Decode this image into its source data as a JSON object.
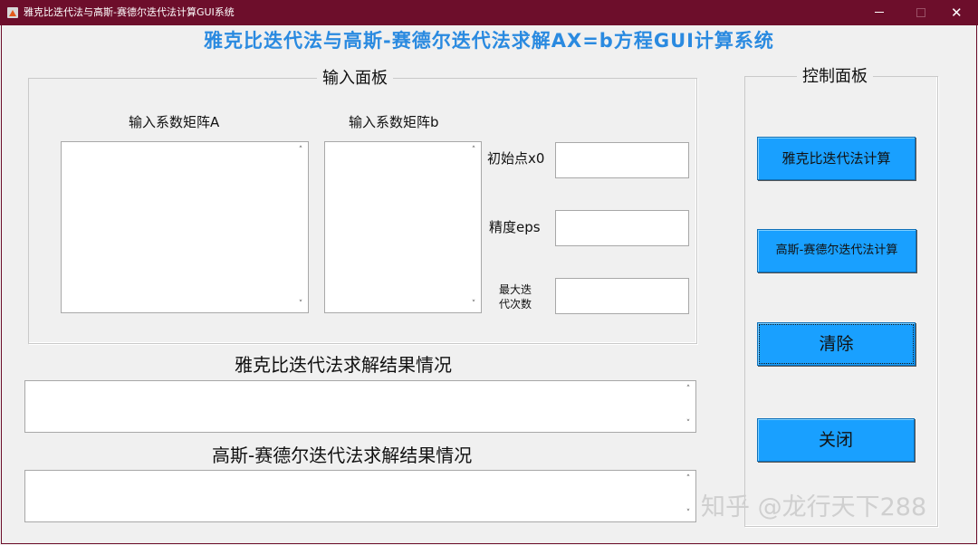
{
  "window": {
    "title": "雅克比迭代法与高斯-赛德尔迭代法计算GUI系统",
    "minimize": "",
    "maximize": "",
    "close": "✕"
  },
  "main_title": "雅克比迭代法与高斯-赛德尔迭代法求解AX=b方程GUI计算系统",
  "input_panel": {
    "title": "输入面板",
    "matrix_a_label": "输入系数矩阵A",
    "matrix_b_label": "输入系数矩阵b",
    "x0_label": "初始点x0",
    "eps_label": "精度eps",
    "max_iter_label_line1": "最大迭",
    "max_iter_label_line2": "代次数",
    "matrix_a_value": "",
    "matrix_b_value": "",
    "x0_value": "",
    "eps_value": "",
    "max_iter_value": ""
  },
  "results": {
    "jacobi_label": "雅克比迭代法求解结果情况",
    "gauss_label": "高斯-赛德尔迭代法求解结果情况",
    "jacobi_value": "",
    "gauss_value": ""
  },
  "control_panel": {
    "title": "控制面板",
    "jacobi_button": "雅克比迭代法计算",
    "gauss_button": "高斯-赛德尔迭代法计算",
    "clear_button": "清除",
    "close_button": "关闭"
  },
  "scroll": {
    "up": "˄",
    "down": "˅"
  },
  "watermark": "知乎 @龙行天下288",
  "colors": {
    "titlebar": "#6d0e2b",
    "title_text": "#2a8ae0",
    "button": "#19a0ff"
  }
}
